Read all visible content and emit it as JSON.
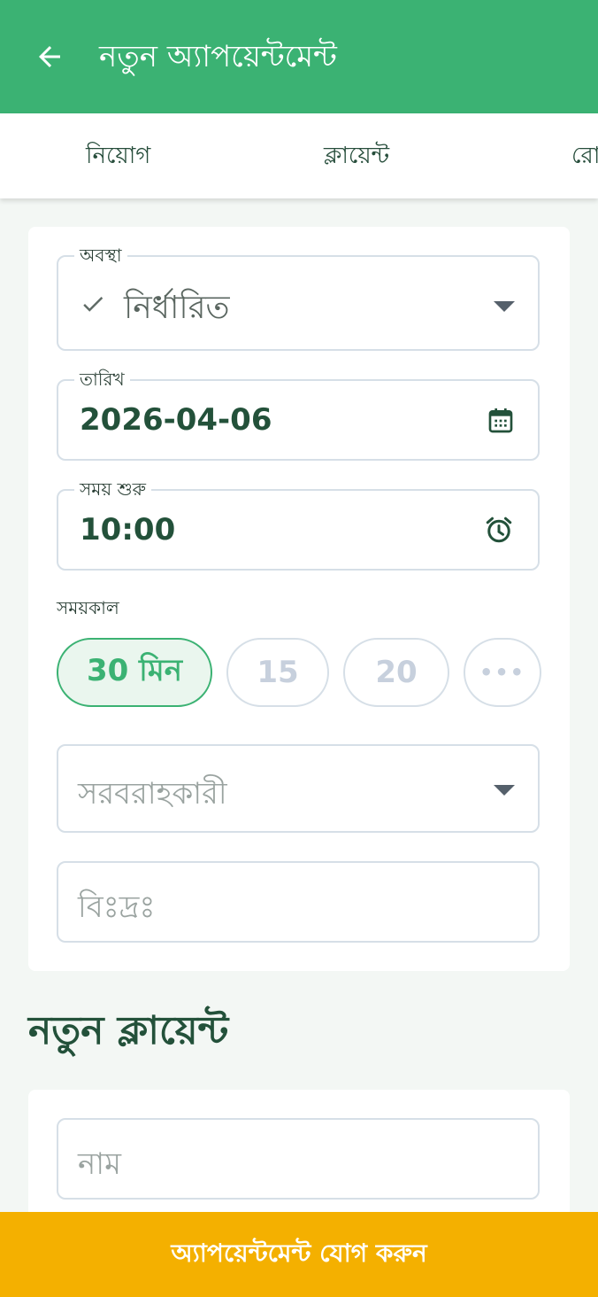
{
  "appbar": {
    "title": "নতুন অ্যাপয়েন্টমেন্ট",
    "back_icon": "arrow-left-icon"
  },
  "tabs": [
    {
      "label": "নিয়োগ"
    },
    {
      "label": "ক্লায়েন্ট"
    },
    {
      "label": "রো"
    }
  ],
  "form": {
    "status": {
      "label": "অবস্থা",
      "value": "নির্ধারিত",
      "icon": "check-icon"
    },
    "date": {
      "label": "তারিখ",
      "value": "2026-04-06",
      "icon": "calendar-icon"
    },
    "start_time": {
      "label": "সময় শুরু",
      "value": "10:00",
      "icon": "alarm-clock-icon"
    },
    "duration": {
      "label": "সময়কাল",
      "options": [
        "30 মিন",
        "15",
        "20",
        "•••"
      ],
      "selected": "30 মিন"
    },
    "provider": {
      "placeholder": "সরবরাহকারী"
    },
    "notes": {
      "placeholder": "বিঃদ্রঃ"
    }
  },
  "client_section": {
    "title": "নতুন ক্লায়েন্ট",
    "name": {
      "placeholder": "নাম"
    }
  },
  "submit_button": {
    "label": "অ্যাপয়েন্টমেন্ট যোগ করুন"
  },
  "colors": {
    "primary": "#3bb273",
    "accent": "#f4b000",
    "text_dark": "#23513a",
    "border": "#d6dfe7"
  }
}
